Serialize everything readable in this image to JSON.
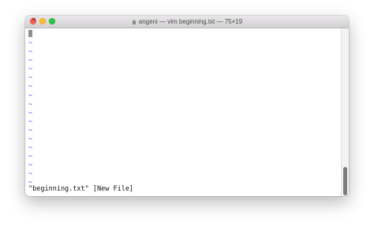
{
  "window": {
    "title": "angeni — vim beginning.txt — 75×19"
  },
  "icons": {
    "close": "close-icon",
    "minimize": "minimize-icon",
    "maximize": "maximize-icon",
    "home": "home-folder-icon"
  },
  "colors": {
    "tilde": "#3a4fe8",
    "close": "#fe5f57",
    "minimize": "#febc2e",
    "maximize": "#28c840"
  },
  "editor": {
    "empty_line_marker": "~",
    "status_message": "\"beginning.txt\" [New File]"
  }
}
